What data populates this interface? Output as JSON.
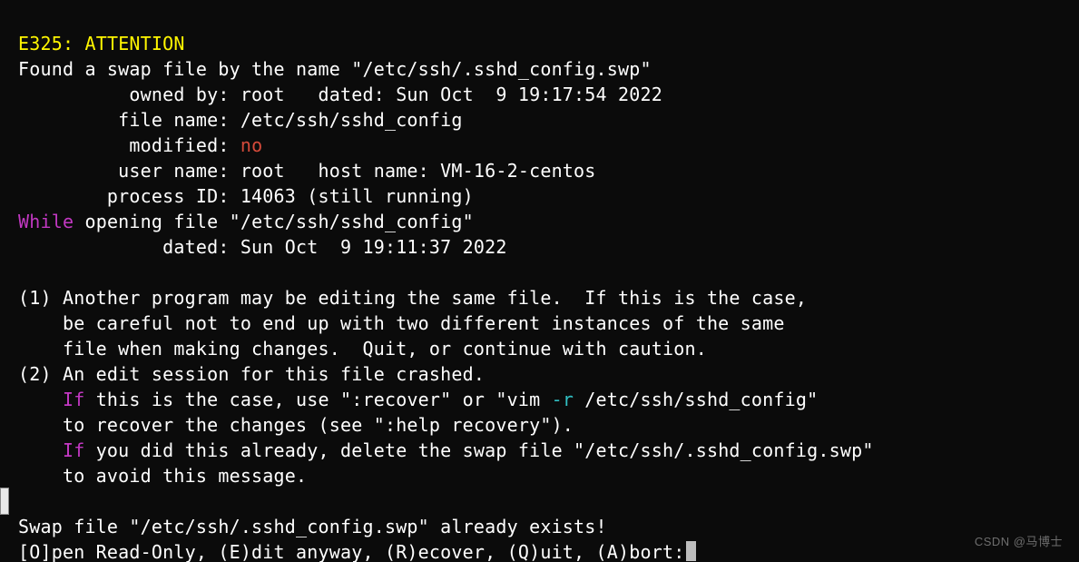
{
  "error_code": "E325:",
  "attention": "ATTENTION",
  "found_line": "Found a swap file by the name \"/etc/ssh/.sshd_config.swp\"",
  "owned_by": "          owned by: root   dated: Sun Oct  9 19:17:54 2022",
  "file_name": "         file name: /etc/ssh/sshd_config",
  "modified_l": "          modified: ",
  "modified_v": "no",
  "user_line": "         user name: root   host name: VM-16-2-centos",
  "pid_line": "        process ID: 14063 (still running)",
  "while_kw": "While",
  "while_rest": " opening file \"/etc/ssh/sshd_config\"",
  "dated2": "             dated: Sun Oct  9 19:11:37 2022",
  "blank": "",
  "p1a": "(1) Another program may be editing the same file.  If this is the case,",
  "p1b": "    be careful not to end up with two different instances of the same",
  "p1c": "    file when making changes.  Quit, or continue with caution.",
  "p2a": "(2) An edit session for this file crashed.",
  "pad4": "    ",
  "if_kw": "If",
  "p2b_mid": " this is the case, use \":recover\" or \"vim ",
  "dash_r": "-r",
  "p2b_end": " /etc/ssh/sshd_config\"",
  "p2c": "    to recover the changes (see \":help recovery\").",
  "p2d_rest": " you did this already, delete the swap file \"/etc/ssh/.sshd_config.swp\"",
  "p2e": "    to avoid this message.",
  "swap_exists": "Swap file \"/etc/ssh/.sshd_config.swp\" already exists!",
  "prompt": "[O]pen Read-Only, (E)dit anyway, (R)ecover, (Q)uit, (A)bort:",
  "watermark": "CSDN @马博士"
}
